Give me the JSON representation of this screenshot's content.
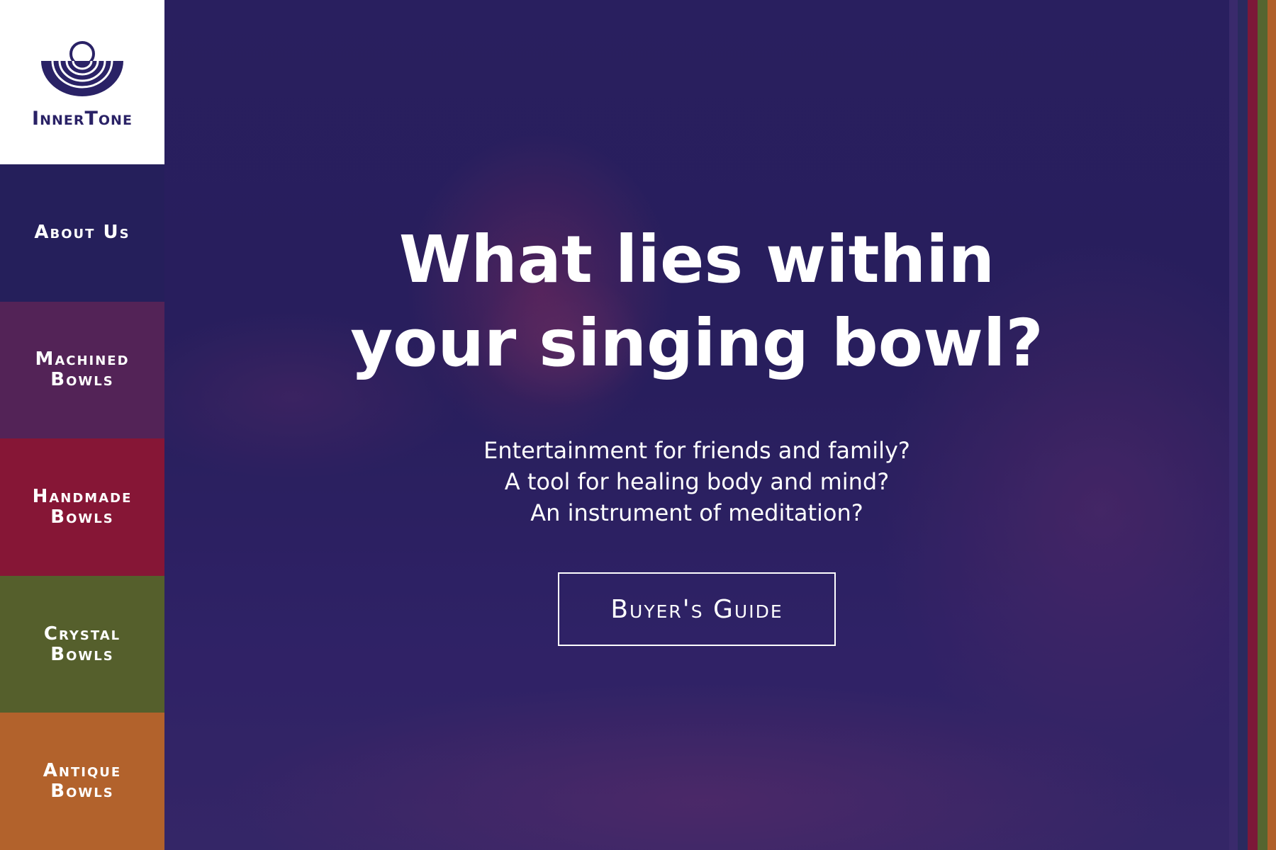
{
  "brand": {
    "name": "InnerTone",
    "logo_icon": "singing-bowl-logo-icon"
  },
  "nav": {
    "items": [
      {
        "lines": [
          "About Us"
        ],
        "color": "#251f5b"
      },
      {
        "lines": [
          "Machined",
          "Bowls"
        ],
        "color": "#532357"
      },
      {
        "lines": [
          "Handmade",
          "Bowls"
        ],
        "color": "#861636"
      },
      {
        "lines": [
          "Crystal",
          "Bowls"
        ],
        "color": "#555f2c"
      },
      {
        "lines": [
          "Antique",
          "Bowls"
        ],
        "color": "#b2622c"
      }
    ]
  },
  "hero": {
    "headline": "What lies within your singing bowl?",
    "questions": [
      "Entertainment for friends and family?",
      "A tool for healing body and mind?",
      "An instrument of meditation?"
    ],
    "cta_label": "Buyer's Guide"
  },
  "accent_stripes": [
    "#3a2a6c",
    "#2a2a5e",
    "#7c1838",
    "#556530",
    "#b0602a"
  ]
}
